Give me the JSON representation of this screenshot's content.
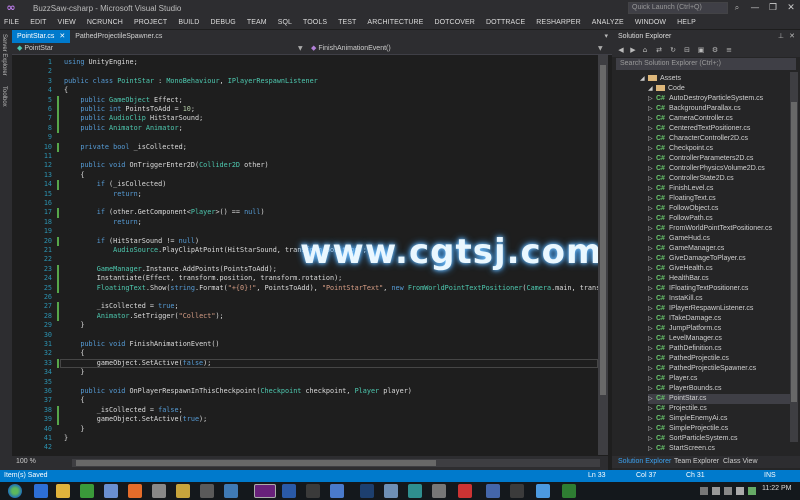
{
  "window": {
    "title": "BuzzSaw-csharp - Microsoft Visual Studio",
    "quick_launch_placeholder": "Quick Launch (Ctrl+Q)",
    "minimize": "—",
    "restore": "❐",
    "close": "✕"
  },
  "menu": [
    "FILE",
    "EDIT",
    "VIEW",
    "NCRUNCH",
    "PROJECT",
    "BUILD",
    "DEBUG",
    "TEAM",
    "SQL",
    "TOOLS",
    "TEST",
    "ARCHITECTURE",
    "DOTCOVER",
    "DOTTRACE",
    "RESHARPER",
    "ANALYZE",
    "WINDOW",
    "HELP"
  ],
  "left_tabs": [
    "Server Explorer",
    "Toolbox"
  ],
  "doc_tabs": [
    {
      "label": "PointStar.cs",
      "active": true
    },
    {
      "label": "PathedProjectileSpawner.cs",
      "active": false
    }
  ],
  "navbar": {
    "class": "PointStar",
    "member": "FinishAnimationEvent()"
  },
  "code": [
    {
      "n": "1",
      "t": "using UnityEngine;"
    },
    {
      "n": "2",
      "t": ""
    },
    {
      "n": "3",
      "t": "public class PointStar : MonoBehaviour, IPlayerRespawnListener"
    },
    {
      "n": "4",
      "t": "{"
    },
    {
      "n": "5",
      "t": "    public GameObject Effect;"
    },
    {
      "n": "6",
      "t": "    public int PointsToAdd = 10;"
    },
    {
      "n": "7",
      "t": "    public AudioClip HitStarSound;"
    },
    {
      "n": "8",
      "t": "    public Animator Animator;"
    },
    {
      "n": "9",
      "t": ""
    },
    {
      "n": "10",
      "t": "    private bool _isCollected;"
    },
    {
      "n": "11",
      "t": ""
    },
    {
      "n": "12",
      "t": "    public void OnTriggerEnter2D(Collider2D other)"
    },
    {
      "n": "13",
      "t": "    {"
    },
    {
      "n": "14",
      "t": "        if (_isCollected)"
    },
    {
      "n": "15",
      "t": "            return;"
    },
    {
      "n": "16",
      "t": ""
    },
    {
      "n": "17",
      "t": "        if (other.GetComponent<Player>() == null)"
    },
    {
      "n": "18",
      "t": "            return;"
    },
    {
      "n": "19",
      "t": ""
    },
    {
      "n": "20",
      "t": "        if (HitStarSound != null)"
    },
    {
      "n": "21",
      "t": "            AudioSource.PlayClipAtPoint(HitStarSound, transform.position);"
    },
    {
      "n": "22",
      "t": ""
    },
    {
      "n": "23",
      "t": "        GameManager.Instance.AddPoints(PointsToAdd);"
    },
    {
      "n": "24",
      "t": "        Instantiate(Effect, transform.position, transform.rotation);"
    },
    {
      "n": "25",
      "t": "        FloatingText.Show(string.Format(\"+{0}!\", PointsToAdd), \"PointStarText\", new FromWorldPointTextPositioner(Camera.main, transform.p"
    },
    {
      "n": "26",
      "t": ""
    },
    {
      "n": "27",
      "t": "        _isCollected = true;"
    },
    {
      "n": "28",
      "t": "        Animator.SetTrigger(\"Collect\");"
    },
    {
      "n": "29",
      "t": "    }"
    },
    {
      "n": "30",
      "t": ""
    },
    {
      "n": "31",
      "t": "    public void FinishAnimationEvent()"
    },
    {
      "n": "32",
      "t": "    {"
    },
    {
      "n": "33",
      "t": "        gameObject.SetActive(false);"
    },
    {
      "n": "34",
      "t": "    }"
    },
    {
      "n": "35",
      "t": ""
    },
    {
      "n": "36",
      "t": "    public void OnPlayerRespawnInThisCheckpoint(Checkpoint checkpoint, Player player)"
    },
    {
      "n": "37",
      "t": "    {"
    },
    {
      "n": "38",
      "t": "        _isCollected = false;"
    },
    {
      "n": "39",
      "t": "        gameObject.SetActive(true);"
    },
    {
      "n": "40",
      "t": "    }"
    },
    {
      "n": "41",
      "t": "}"
    },
    {
      "n": "42",
      "t": ""
    }
  ],
  "watermark": "www.cgtsj.com",
  "zoom": "100 %",
  "solution_explorer": {
    "title": "Solution Explorer",
    "search_placeholder": "Search Solution Explorer (Ctrl+;)",
    "folders": [
      "Assets",
      "Code"
    ],
    "files": [
      "AutoDestroyParticleSystem.cs",
      "BackgroundParallax.cs",
      "CameraController.cs",
      "CenteredTextPositioner.cs",
      "CharacterController2D.cs",
      "Checkpoint.cs",
      "ControllerParameters2D.cs",
      "ControllerPhysicsVolume2D.cs",
      "ControllerState2D.cs",
      "FinishLevel.cs",
      "FloatingText.cs",
      "FollowObject.cs",
      "FollowPath.cs",
      "FromWorldPointTextPositioner.cs",
      "GameHud.cs",
      "GameManager.cs",
      "GiveDamageToPlayer.cs",
      "GiveHealth.cs",
      "HealthBar.cs",
      "IFloatingTextPositioner.cs",
      "InstaKill.cs",
      "IPlayerRespawnListener.cs",
      "ITakeDamage.cs",
      "JumpPlatform.cs",
      "LevelManager.cs",
      "PathDefinition.cs",
      "PathedProjectile.cs",
      "PathedProjectileSpawner.cs",
      "Player.cs",
      "PlayerBounds.cs",
      "PointStar.cs",
      "Projectile.cs",
      "SimpleEnemyAi.cs",
      "SimpleProjectile.cs",
      "SortParticleSystem.cs",
      "StartScreen.cs"
    ],
    "selected": "PointStar.cs",
    "tabs": [
      "Solution Explorer",
      "Team Explorer",
      "Class View"
    ]
  },
  "status": {
    "left": "Item(s) Saved",
    "ln": "Ln 33",
    "col": "Col 37",
    "ch": "Ch 31",
    "mode": "INS"
  },
  "taskbar": {
    "clock": "11:22 PM"
  }
}
